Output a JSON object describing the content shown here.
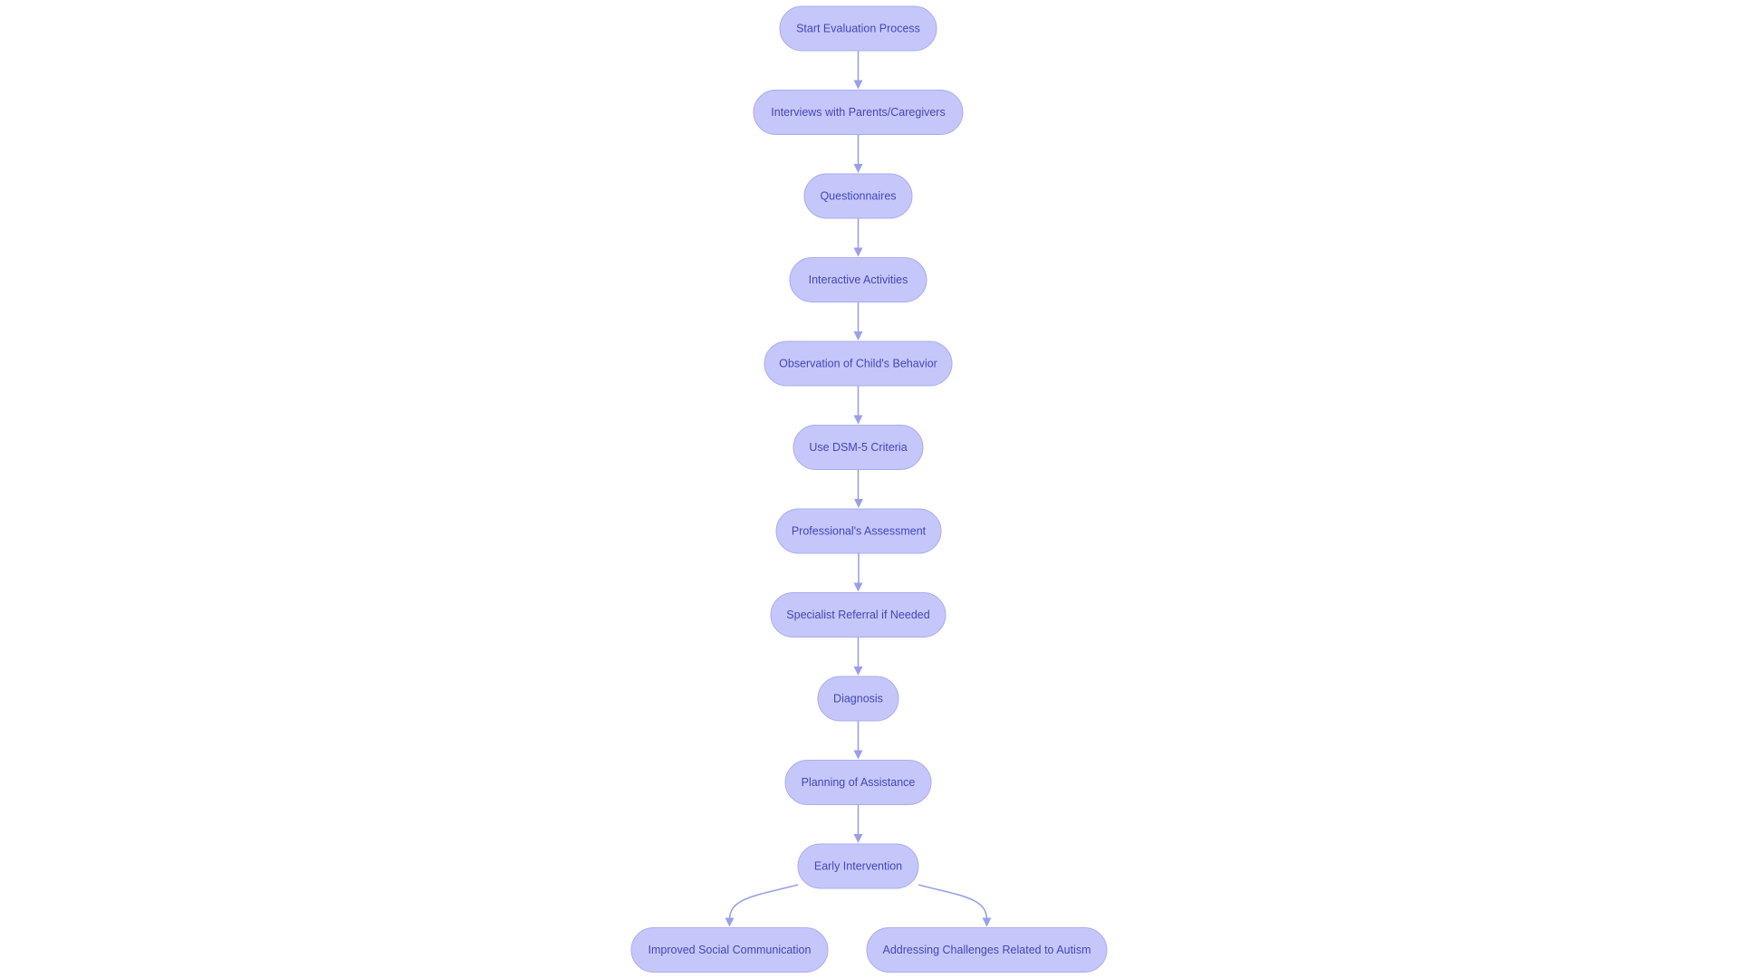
{
  "diagram": {
    "type": "flowchart",
    "direction": "top-down",
    "colors": {
      "node_fill": "#c5c7fb",
      "node_border": "#a9acef",
      "node_text": "#4446b8",
      "edge": "#9aa0e8",
      "background": "#ffffff"
    },
    "nodes": [
      {
        "id": "start",
        "label": "Start Evaluation Process"
      },
      {
        "id": "interviews",
        "label": "Interviews with Parents/Caregivers"
      },
      {
        "id": "questionnaires",
        "label": "Questionnaires"
      },
      {
        "id": "interactive",
        "label": "Interactive Activities"
      },
      {
        "id": "observation",
        "label": "Observation of Child's Behavior"
      },
      {
        "id": "dsm5",
        "label": "Use DSM-5 Criteria"
      },
      {
        "id": "professional",
        "label": "Professional's Assessment"
      },
      {
        "id": "referral",
        "label": "Specialist Referral if Needed"
      },
      {
        "id": "diagnosis",
        "label": "Diagnosis"
      },
      {
        "id": "planning",
        "label": "Planning of Assistance"
      },
      {
        "id": "early",
        "label": "Early Intervention"
      },
      {
        "id": "social",
        "label": "Improved Social Communication"
      },
      {
        "id": "challenges",
        "label": "Addressing Challenges Related to Autism"
      }
    ],
    "edges": [
      {
        "from": "start",
        "to": "interviews"
      },
      {
        "from": "interviews",
        "to": "questionnaires"
      },
      {
        "from": "questionnaires",
        "to": "interactive"
      },
      {
        "from": "interactive",
        "to": "observation"
      },
      {
        "from": "observation",
        "to": "dsm5"
      },
      {
        "from": "dsm5",
        "to": "professional"
      },
      {
        "from": "professional",
        "to": "referral"
      },
      {
        "from": "referral",
        "to": "diagnosis"
      },
      {
        "from": "diagnosis",
        "to": "planning"
      },
      {
        "from": "planning",
        "to": "early"
      },
      {
        "from": "early",
        "to": "social"
      },
      {
        "from": "early",
        "to": "challenges"
      }
    ]
  }
}
